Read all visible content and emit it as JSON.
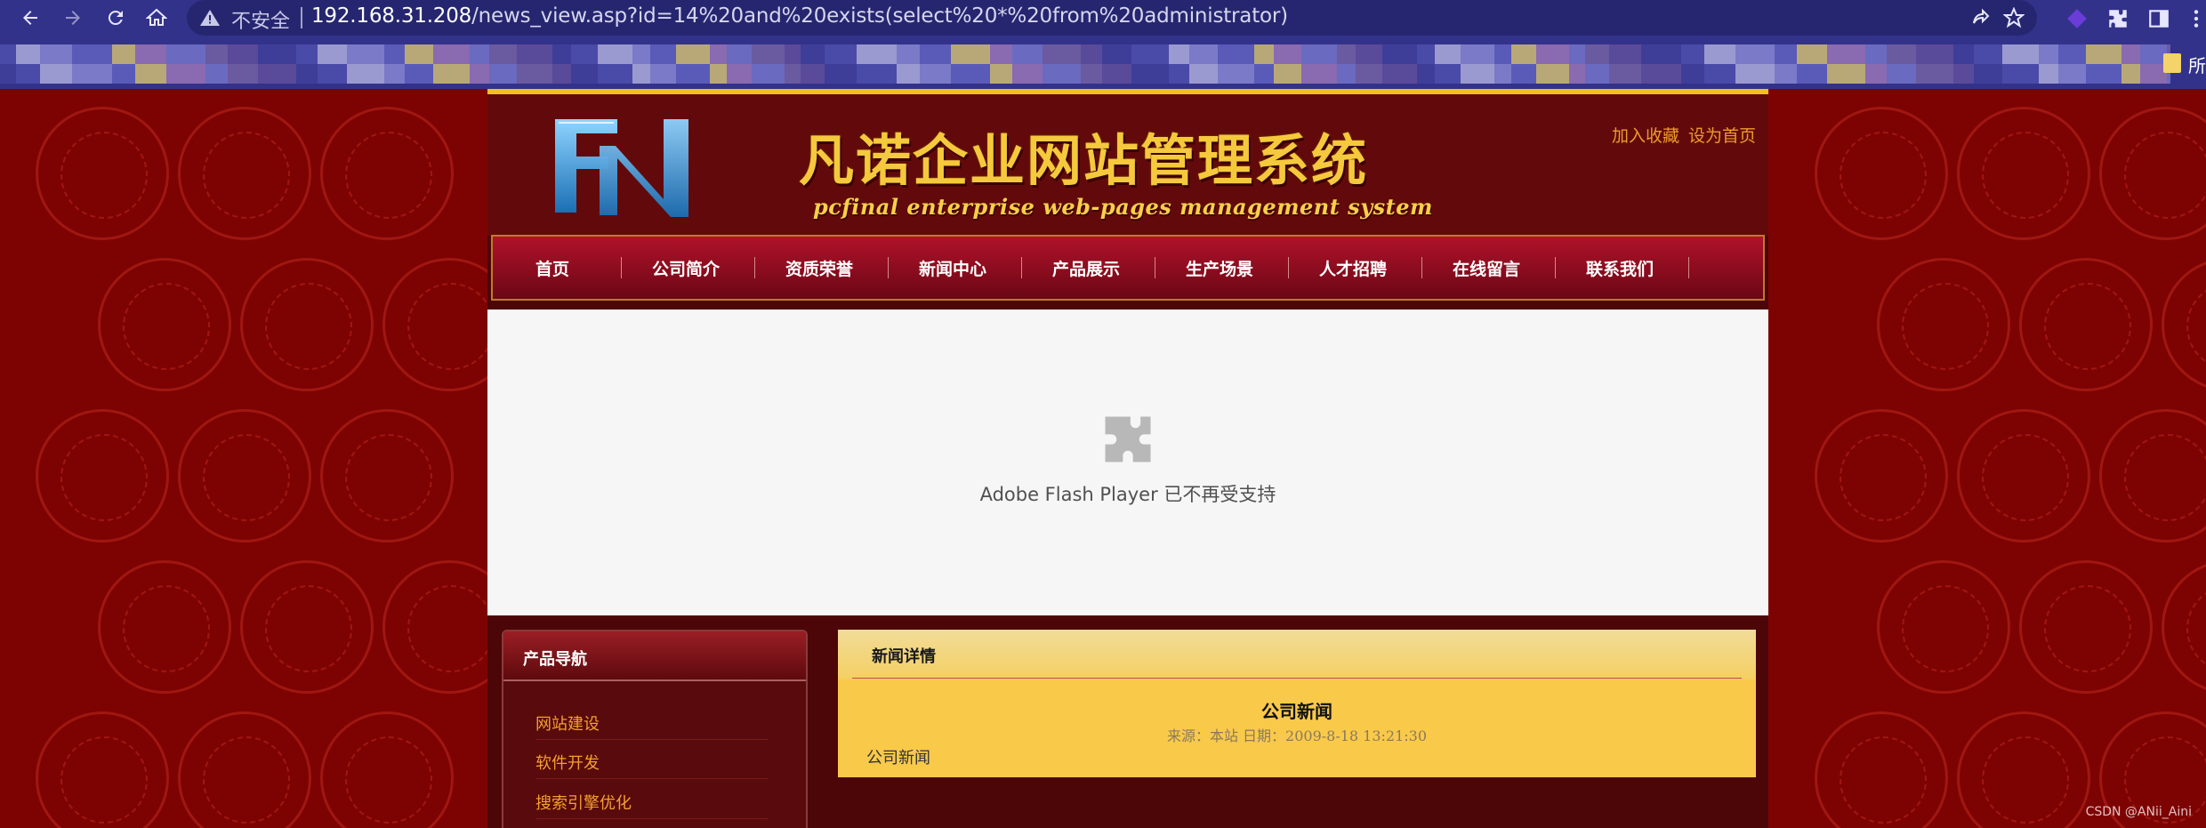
{
  "browser": {
    "security_label": "不安全",
    "url_host": "192.168.31.208",
    "url_path": "/news_view.asp?id=14%20and%20exists(select%20*%20from%20administrator)",
    "bookmark_label": "所"
  },
  "site": {
    "title": "凡诺企业网站管理系统",
    "subtitle": "pcfinal enterprise web-pages management system",
    "header_links": [
      "加入收藏",
      "设为首页"
    ],
    "nav": [
      "首页",
      "公司简介",
      "资质荣誉",
      "新闻中心",
      "产品展示",
      "生产场景",
      "人才招聘",
      "在线留言",
      "联系我们"
    ],
    "flash_message": "Adobe Flash Player 已不再受支持",
    "sidebar": {
      "title": "产品导航",
      "items": [
        "网站建设",
        "软件开发",
        "搜索引擎优化"
      ]
    },
    "news": {
      "panel_title": "新闻详情",
      "article_title": "公司新闻",
      "meta": "来源：本站 日期：2009-8-18 13:21:30",
      "body": "公司新闻"
    }
  },
  "watermark": "CSDN @ANii_Aini",
  "colors": {
    "chrome": "#33328a",
    "page_bg": "#7d0303",
    "gold": "#f5c93c",
    "nav_red": "#8a0c1e",
    "news_yellow": "#f9c94a"
  }
}
